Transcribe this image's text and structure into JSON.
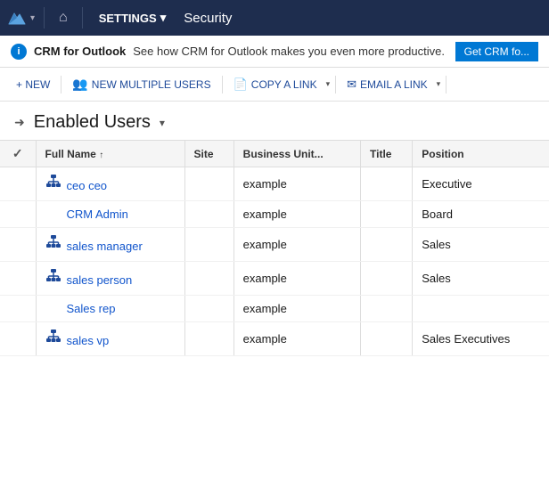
{
  "nav": {
    "logo_icon": "⛰",
    "chevron": "▾",
    "home_icon": "⌂",
    "settings_label": "SETTINGS",
    "settings_chevron": "▾",
    "page_title": "Security"
  },
  "banner": {
    "info_icon": "i",
    "title": "CRM for Outlook",
    "text": "See how CRM for Outlook makes you even more productive.",
    "cta_label": "Get CRM fo..."
  },
  "toolbar": {
    "new_label": "+ NEW",
    "new_multiple_label": "NEW MULTIPLE USERS",
    "copy_link_label": "COPY A LINK",
    "copy_chevron": "▾",
    "email_link_label": "EMAIL A LINK",
    "email_chevron": "▾"
  },
  "section": {
    "title": "Enabled Users",
    "chevron": "▾"
  },
  "table": {
    "columns": [
      {
        "id": "checkbox",
        "label": "✓",
        "sortable": false
      },
      {
        "id": "full_name",
        "label": "Full Name",
        "sortable": true
      },
      {
        "id": "site",
        "label": "Site"
      },
      {
        "id": "business_unit",
        "label": "Business Unit..."
      },
      {
        "id": "title",
        "label": "Title"
      },
      {
        "id": "position",
        "label": "Position"
      }
    ],
    "rows": [
      {
        "icon": true,
        "full_name": "ceo ceo",
        "site": "",
        "business_unit": "example",
        "title": "",
        "position": "Executive"
      },
      {
        "icon": false,
        "full_name": "CRM Admin",
        "site": "",
        "business_unit": "example",
        "title": "",
        "position": "Board"
      },
      {
        "icon": true,
        "full_name": "sales manager",
        "site": "",
        "business_unit": "example",
        "title": "",
        "position": "Sales"
      },
      {
        "icon": true,
        "full_name": "sales person",
        "site": "",
        "business_unit": "example",
        "title": "",
        "position": "Sales"
      },
      {
        "icon": false,
        "full_name": "Sales rep",
        "site": "",
        "business_unit": "example",
        "title": "",
        "position": ""
      },
      {
        "icon": true,
        "full_name": "sales vp",
        "site": "",
        "business_unit": "example",
        "title": "",
        "position": "Sales Executives"
      }
    ]
  }
}
